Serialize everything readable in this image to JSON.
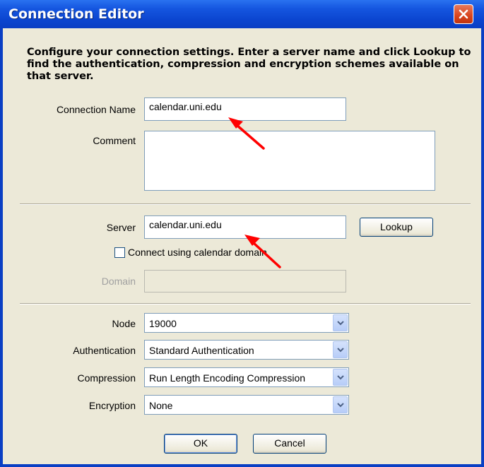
{
  "window": {
    "title": "Connection Editor",
    "instructions": "Configure your connection settings. Enter a server name and click Lookup to find the authentication, compression and encryption schemes available on that server."
  },
  "form": {
    "connection_name_label": "Connection Name",
    "connection_name_value": "calendar.uni.edu",
    "comment_label": "Comment",
    "comment_value": "",
    "server_label": "Server",
    "server_value": "calendar.uni.edu",
    "lookup_label": "Lookup",
    "connect_domain_label": "Connect using calendar domain",
    "connect_domain_checked": false,
    "domain_label": "Domain",
    "domain_value": "",
    "node_label": "Node",
    "node_value": "19000",
    "authentication_label": "Authentication",
    "authentication_value": "Standard Authentication",
    "compression_label": "Compression",
    "compression_value": "Run Length Encoding Compression",
    "encryption_label": "Encryption",
    "encryption_value": "None"
  },
  "buttons": {
    "ok": "OK",
    "cancel": "Cancel"
  },
  "colors": {
    "titlebar": "#0a3fc4",
    "dialog_bg": "#ece9d8",
    "annotation_arrow": "#ff0000"
  },
  "icons": {
    "close": "close-icon",
    "dropdown": "chevron-down-icon"
  }
}
